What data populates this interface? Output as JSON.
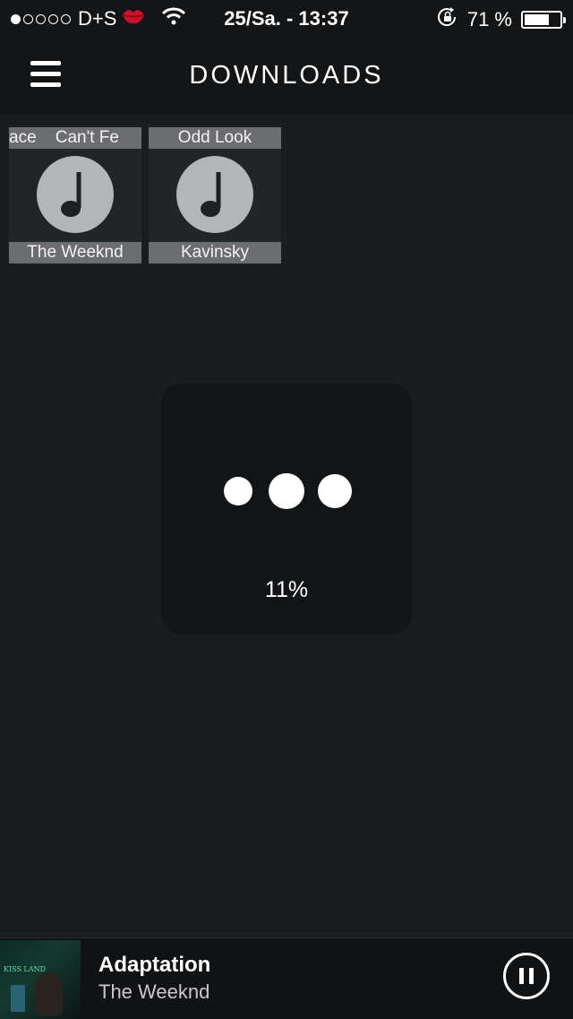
{
  "status_bar": {
    "signal_dots": [
      true,
      false,
      false,
      false,
      false
    ],
    "carrier": "D+S",
    "emoji_icon": "kiss-lips-icon",
    "time": "25/Sa. - 13:37",
    "battery_text": "71 %",
    "battery_level": 0.71
  },
  "nav": {
    "title": "DOWNLOADS",
    "menu_icon": "hamburger-menu-icon"
  },
  "albums": [
    {
      "top_text": "ace    Can't Fe",
      "artist": "The Weeknd",
      "icon": "music-note-icon"
    },
    {
      "top_text": "Odd Look",
      "artist": "Kavinsky",
      "icon": "music-note-icon"
    }
  ],
  "loading": {
    "percent_text": "11%"
  },
  "now_playing": {
    "album_art_text": "KISS LAND",
    "title": "Adaptation",
    "artist": "The Weeknd",
    "control_icon": "pause-icon"
  },
  "colors": {
    "background": "#1b1c1e",
    "bar": "#141516",
    "tile_label": "#6c6d70",
    "note_circle": "#b4b5b8"
  }
}
